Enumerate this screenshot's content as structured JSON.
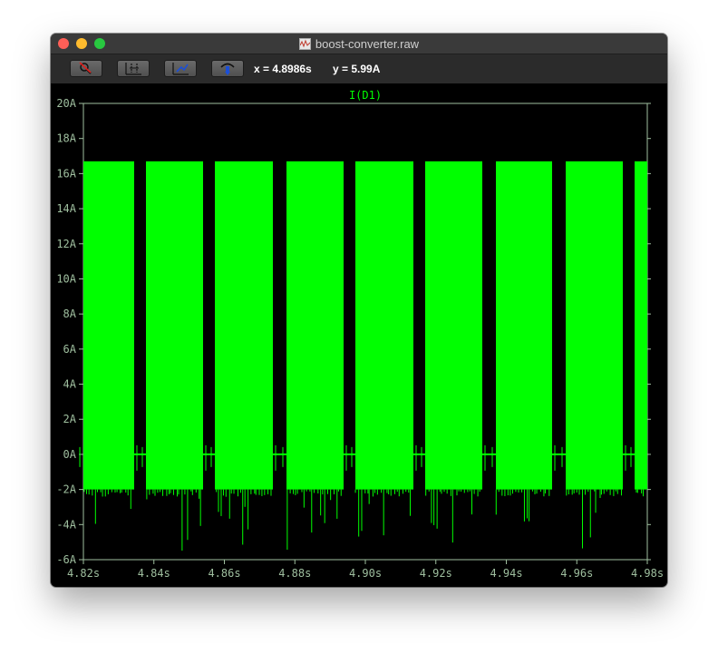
{
  "window": {
    "title": "boost-converter.raw"
  },
  "toolbar": {
    "buttons": [
      {
        "name": "zoom-button",
        "icon": "magnifier-cancel-icon"
      },
      {
        "name": "autorange-button",
        "icon": "autorange-icon"
      },
      {
        "name": "pan-button",
        "icon": "pan-icon"
      },
      {
        "name": "probe-button",
        "icon": "probe-icon"
      }
    ],
    "x_readout": "x = 4.8986s",
    "y_readout": "y = 5.99A"
  },
  "colors": {
    "trace": "#00ff00",
    "background": "#000000",
    "axis": "#9fbf9f"
  },
  "chart_data": {
    "type": "line",
    "title": "I(D1)",
    "xlabel": "",
    "ylabel": "",
    "xlim": [
      4.82,
      4.98
    ],
    "ylim": [
      -6,
      20
    ],
    "x_ticks": [
      "4.82s",
      "4.84s",
      "4.86s",
      "4.88s",
      "4.90s",
      "4.92s",
      "4.94s",
      "4.96s",
      "4.98s"
    ],
    "y_ticks": [
      "20A",
      "18A",
      "16A",
      "14A",
      "12A",
      "10A",
      "8A",
      "6A",
      "4A",
      "2A",
      "0A",
      "-2A",
      "-4A",
      "-6A"
    ],
    "series": [
      {
        "name": "I(D1)",
        "envelope_peak": 16.7,
        "envelope_min": -2.0,
        "idle_level": 0,
        "bursts": [
          [
            4.82,
            4.8353
          ],
          [
            4.8372,
            4.8487
          ],
          [
            4.8412,
            4.8487
          ],
          [
            4.8571,
            4.8675
          ],
          [
            4.8671,
            4.8793
          ],
          [
            4.8768,
            4.8951
          ],
          [
            4.8867,
            4.9151
          ],
          [
            4.9052,
            4.9146
          ],
          [
            4.9172,
            4.9284
          ],
          [
            4.9272,
            4.9508
          ],
          [
            4.958,
            4.9744
          ],
          [
            4.9762,
            4.98
          ]
        ]
      }
    ]
  }
}
